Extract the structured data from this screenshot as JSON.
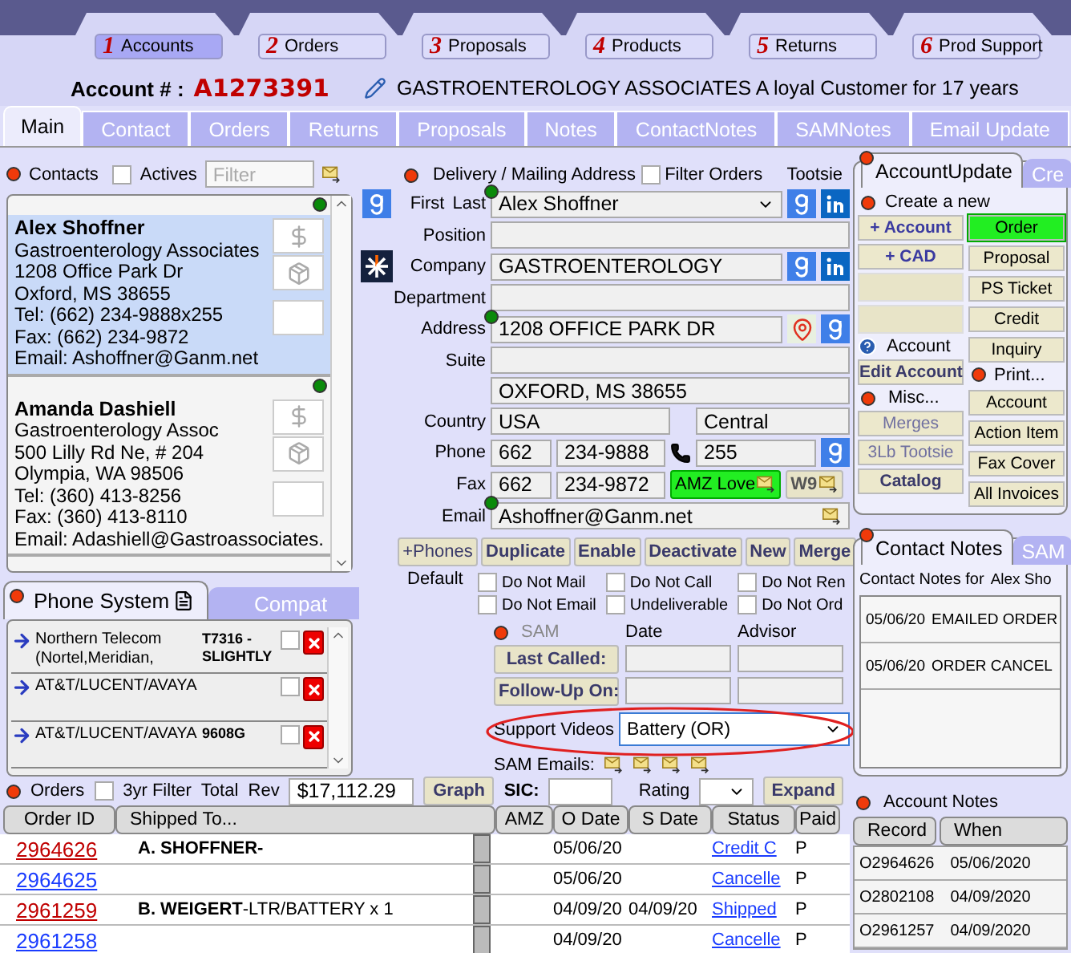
{
  "module_tabs": [
    {
      "number": "1",
      "label": "Accounts",
      "selected": true
    },
    {
      "number": "2",
      "label": "Orders",
      "selected": false
    },
    {
      "number": "3",
      "label": "Proposals",
      "selected": false
    },
    {
      "number": "4",
      "label": "Products",
      "selected": false
    },
    {
      "number": "5",
      "label": "Returns",
      "selected": false
    },
    {
      "number": "6",
      "label": "Prod Support",
      "selected": false
    }
  ],
  "account": {
    "label": "Account # :",
    "number": "A1273391",
    "description": "GASTROENTEROLOGY ASSOCIATES A loyal Customer for 17 years"
  },
  "tabs": [
    {
      "label": "Main",
      "selected": true
    },
    {
      "label": "Contact",
      "selected": false
    },
    {
      "label": "Orders",
      "selected": false
    },
    {
      "label": "Returns",
      "selected": false
    },
    {
      "label": "Proposals",
      "selected": false
    },
    {
      "label": "Notes",
      "selected": false
    },
    {
      "label": "ContactNotes",
      "selected": false
    },
    {
      "label": "SAMNotes",
      "selected": false
    },
    {
      "label": "Email Update",
      "selected": false
    }
  ],
  "contacts": {
    "label": "Contacts",
    "actives_label": "Actives",
    "actives_checked": false,
    "filter_placeholder": "Filter",
    "items": [
      {
        "name": "Alex Shoffner",
        "lines": [
          "Gastroenterology Associates",
          "1208 Office Park Dr",
          "Oxford, MS 38655",
          "Tel: (662) 234-9888x255",
          "Fax: (662) 234-9872"
        ],
        "email": "Email: Ashoffner@Ganm.net",
        "selected": true
      },
      {
        "name": "Amanda Dashiell",
        "lines": [
          "Gastroenterology Assoc",
          "500 Lilly Rd Ne, # 204",
          "Olympia, WA 98506",
          "Tel: (360) 413-8256",
          "Fax: (360) 413-8110"
        ],
        "email": "Email: Adashiell@Gastroassociates.",
        "selected": false
      }
    ]
  },
  "phone_system": {
    "tabs": [
      {
        "label": "Phone System",
        "selected": true
      },
      {
        "label": "Compat",
        "selected": false
      }
    ],
    "rows": [
      {
        "brand": "Northern Telecom (Nortel,Meridian,",
        "model": "T7316 - SLIGHTLY",
        "checked": false
      },
      {
        "brand": "AT&T/LUCENT/AVAYA",
        "model": "",
        "checked": false
      },
      {
        "brand": "AT&T/LUCENT/AVAYA",
        "model": "9608G",
        "checked": false
      }
    ]
  },
  "form": {
    "header": "Delivery / Mailing Address",
    "filter_label": "Filter Orders",
    "filter_checked": false,
    "tootsie": "Tootsie",
    "name": {
      "labels": [
        "First",
        "Last"
      ],
      "value": "Alex Shoffner"
    },
    "position": {
      "label": "Position"
    },
    "company": {
      "label": "Company",
      "value": "GASTROENTEROLOGY"
    },
    "department": {
      "label": "Department"
    },
    "address": {
      "label": "Address",
      "value": "1208 OFFICE PARK DR"
    },
    "suite": {
      "label": "Suite"
    },
    "city": {
      "value": "OXFORD, MS 38655"
    },
    "country": {
      "label": "Country",
      "value": "USA",
      "region": "Central"
    },
    "phone": {
      "label": "Phone",
      "area": "662",
      "number": "234-9888",
      "ext": "255"
    },
    "fax": {
      "label": "Fax",
      "area": "662",
      "number": "234-9872",
      "amz": "AMZ Love",
      "w9": "W9"
    },
    "email": {
      "label": "Email",
      "value": "Ashoffner@Ganm.net"
    },
    "actions": [
      "+Phones",
      "Duplicate",
      "Enable",
      "Deactivate",
      "New",
      "Merge"
    ],
    "default_label": "Default",
    "flags": [
      {
        "label": "Do Not Mail",
        "checked": false
      },
      {
        "label": "Do Not Call",
        "checked": false
      },
      {
        "label": "Do Not Ren",
        "checked": false
      },
      {
        "label": "Do Not Email",
        "checked": false
      },
      {
        "label": "Undeliverable",
        "checked": false
      },
      {
        "label": "Do Not Ord",
        "checked": false
      }
    ]
  },
  "sam": {
    "label": "SAM",
    "date_label": "Date",
    "advisor_label": "Advisor",
    "last_called": "Last Called:",
    "follow_up": "Follow-Up On:",
    "videos_label": "Support Videos",
    "videos_value": "Battery (OR)",
    "emails_label": "SAM Emails:"
  },
  "account_update": {
    "tabs": [
      {
        "label": "AccountUpdate",
        "selected": true
      },
      {
        "label": "Cre",
        "selected": false
      }
    ],
    "create_label": "Create a new",
    "create_buttons": [
      "+ Account",
      "+ CAD"
    ],
    "account_label": "Account",
    "edit_button": "Edit Account",
    "misc_label": "Misc...",
    "misc_buttons": [
      {
        "label": "Merges",
        "disabled": true
      },
      {
        "label": "3Lb Tootsie",
        "disabled": true
      },
      {
        "label": "Catalog",
        "disabled": false
      }
    ],
    "type_buttons": [
      {
        "label": "Order",
        "selected": true
      },
      {
        "label": "Proposal",
        "selected": false
      },
      {
        "label": "PS Ticket",
        "selected": false
      },
      {
        "label": "Credit",
        "selected": false
      },
      {
        "label": "Inquiry",
        "selected": false
      }
    ],
    "print_label": "Print...",
    "print_buttons": [
      "Account",
      "Action Item",
      "Fax Cover",
      "All Invoices"
    ]
  },
  "contact_notes": {
    "tabs": [
      {
        "label": "Contact Notes",
        "selected": true
      },
      {
        "label": "SAM",
        "selected": false
      }
    ],
    "for_label": "Contact Notes for",
    "for_name": "Alex Sho",
    "rows": [
      {
        "date": "05/06/20",
        "text": "EMAILED ORDER"
      },
      {
        "date": "05/06/20",
        "text": "ORDER CANCEL"
      }
    ]
  },
  "orders": {
    "label": "Orders",
    "filter_label": "3yr Filter",
    "filter_checked": false,
    "total_label": "Total  Rev",
    "total": "$17,112.29",
    "graph": "Graph",
    "sic_label": "SIC:",
    "rating_label": "Rating",
    "expand": "Expand",
    "columns": [
      "Order ID",
      "Shipped To...",
      "AMZ",
      "O Date",
      "S Date",
      "Status",
      "Paid"
    ],
    "rows": [
      {
        "id": "2964626",
        "color": "#c00000",
        "shipped": "**A. SHOFFNER-**",
        "o_date": "05/06/20",
        "s_date": "",
        "status": "Credit C",
        "paid": "P"
      },
      {
        "id": "2964625",
        "color": "#1a3cff",
        "shipped": "",
        "o_date": "05/06/20",
        "s_date": "",
        "status": "Cancelle",
        "paid": "P"
      },
      {
        "id": "2961259",
        "color": "#c00000",
        "shipped": "**B. WEIGERT**-LTR/BATTERY x 1",
        "o_date": "04/09/20",
        "s_date": "04/09/20",
        "status": "Shipped",
        "paid": "P"
      },
      {
        "id": "2961258",
        "color": "#1a3cff",
        "shipped": "",
        "o_date": "04/09/20",
        "s_date": "",
        "status": "Cancelle",
        "paid": "P"
      }
    ]
  },
  "account_notes": {
    "label": "Account Notes",
    "columns": [
      "Record",
      "When"
    ],
    "rows": [
      {
        "record": "O2964626",
        "when": "05/06/2020"
      },
      {
        "record": "O2802108",
        "when": "04/09/2020"
      },
      {
        "record": "O2961257",
        "when": "04/09/2020"
      }
    ]
  }
}
